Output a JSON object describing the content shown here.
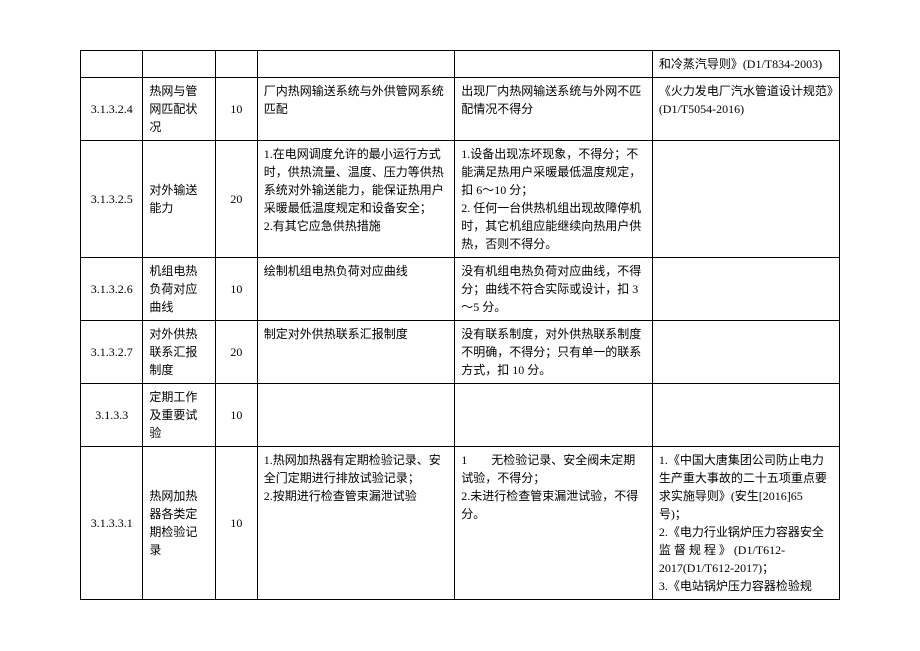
{
  "rows": [
    {
      "id": "",
      "name": "",
      "score": "",
      "desc": "",
      "criteria": "",
      "ref": "和冷蒸汽导则》(D1/T834-2003)"
    },
    {
      "id": "3.1.3.2.4",
      "name": "热网与管网匹配状况",
      "score": "10",
      "desc": "厂内热网输送系统与外供管网系统匹配",
      "criteria": "出现厂内热网输送系统与外网不匹配情况不得分",
      "ref": "《火力发电厂汽水管道设计规范》(D1/T5054-2016)"
    },
    {
      "id": "3.1.3.2.5",
      "name": "对外输送能力",
      "score": "20",
      "desc": "1.在电网调度允许的最小运行方式时，供热流量、温度、压力等供热系统对外输送能力，能保证热用户采暖最低温度规定和设备安全；\n2.有其它应急供热措施",
      "criteria": "1.设备出现冻坏现象，不得分；不能满足热用户采暖最低温度规定，扣 6～10 分；\n2. 任何一台供热机组出现故障停机时，其它机组应能继续向热用户供热，否则不得分。",
      "ref": ""
    },
    {
      "id": "3.1.3.2.6",
      "name": "机组电热负荷对应曲线",
      "score": "10",
      "desc": "绘制机组电热负荷对应曲线",
      "criteria": "没有机组电热负荷对应曲线，不得分；曲线不符合实际或设计，扣 3～5 分。",
      "ref": ""
    },
    {
      "id": "3.1.3.2.7",
      "name": "对外供热联系汇报制度",
      "score": "20",
      "desc": "制定对外供热联系汇报制度",
      "criteria": "没有联系制度，对外供热联系制度不明确，不得分；只有单一的联系方式，扣 10 分。",
      "ref": ""
    },
    {
      "id": "3.1.3.3",
      "name": "定期工作及重要试验",
      "score": "10",
      "desc": "",
      "criteria": "",
      "ref": ""
    },
    {
      "id": "3.1.3.3.1",
      "name": "热网加热器各类定期检验记录",
      "score": "10",
      "desc": "1.热网加热器有定期检验记录、安全门定期进行排放试验记录；\n2.按期进行检查管束漏泄试验",
      "criteria": "1　　无检验记录、安全阀未定期试验，不得分；\n2.未进行检查管束漏泄试验，不得分。",
      "ref": "1.《中国大唐集团公司防止电力生产重大事故的二十五项重点要求实施导则》(安生[2016]65 号)；\n2.《电力行业锅炉压力容器安全监 督 规 程 》 (D1/T612-2017(D1/T612-2017)；\n3.《电站锅炉压力容器检验规"
    }
  ]
}
